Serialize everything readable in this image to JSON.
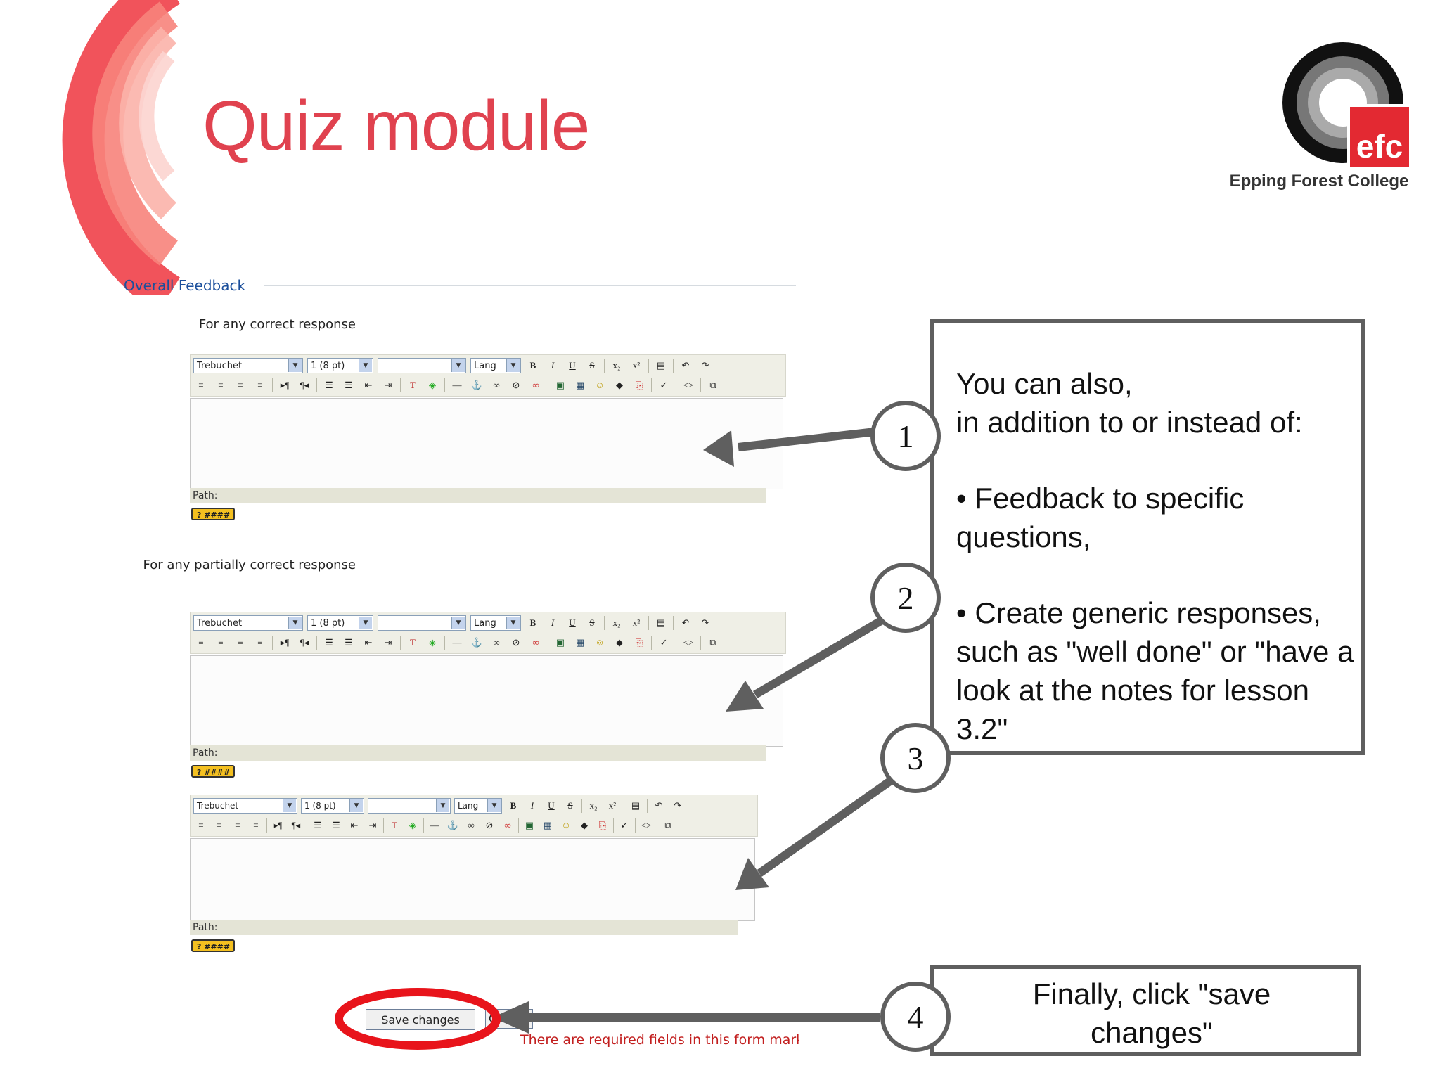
{
  "slide": {
    "title": "Quiz module",
    "logo_text": "Epping Forest College",
    "logo_mark": "efc"
  },
  "colors": {
    "accent_red": "#e0424f",
    "link_blue": "#1b4f9c",
    "callout_gray": "#5f5f5f",
    "highlight_red": "#e8141b"
  },
  "form": {
    "section_title": "Overall Feedback",
    "blocks": [
      {
        "label": "For any correct response"
      },
      {
        "label": "For any partially correct response"
      },
      {
        "label": ""
      }
    ],
    "toolbar": {
      "font_select": "Trebuchet",
      "size_select": "1 (8 pt)",
      "style_select": "",
      "lang_select": "Lang"
    },
    "path_label": "Path:",
    "save_label": "Save changes",
    "cancel_label": "Cancel",
    "required_note": "There are required fields in this form marked"
  },
  "callouts": {
    "main": {
      "line1": "You can also,",
      "line2": "in addition to or instead of:",
      "bullet1": "• Feedback to specific questions,",
      "bullet2": "• Create generic responses, such as \"well done\" or \"have a look at the notes for lesson 3.2\""
    },
    "final": "Finally, click \"save changes\"",
    "badges": [
      "1",
      "2",
      "3",
      "4"
    ]
  }
}
